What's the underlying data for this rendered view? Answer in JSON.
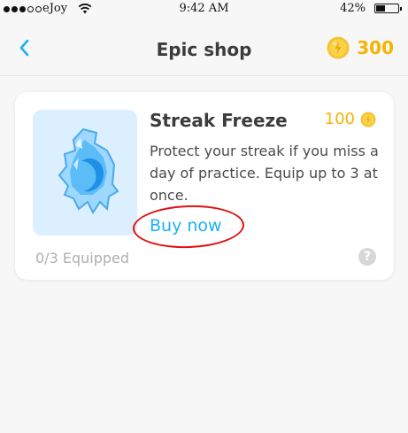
{
  "status_bar": {
    "carrier": "eJoy",
    "time": "9:42 AM",
    "battery_percent": "42%",
    "battery_level": 0.42,
    "signal_bars_filled": 3,
    "signal_bars_total": 5
  },
  "nav": {
    "title": "Epic shop",
    "back_icon": "chevron-left-icon",
    "gem_count": "300",
    "gem_icon": "gold-coin-icon"
  },
  "shop_item": {
    "image_icon": "streak-freeze-ice-icon",
    "title": "Streak Freeze",
    "price": "100",
    "price_icon": "gold-coin-icon",
    "description": "Protect your streak if you miss a day of practice. Equip up to 3 at once.",
    "buy_label": "Buy now",
    "equipped_status": "0/3 Equipped",
    "help_label": "?"
  },
  "colors": {
    "accent_blue": "#1cb0f6",
    "gold": "#f5b400",
    "annotation_red": "#e01010",
    "muted_text": "#afafaf"
  }
}
